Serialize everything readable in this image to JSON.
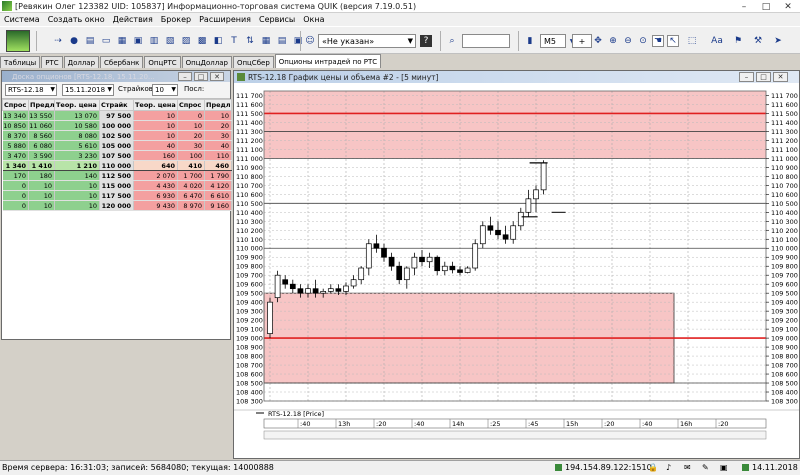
{
  "window": {
    "title": "[Ревякин Олег 123382 UID: 105837] Информационно-торговая система QUIK (версия 7.19.0.51)",
    "minimize": "–",
    "maximize": "□",
    "close": "✕"
  },
  "menu": [
    "Система",
    "Создать окно",
    "Действия",
    "Брокер",
    "Расширения",
    "Сервисы",
    "Окна"
  ],
  "toolbar": {
    "account_select": "«Не указан»",
    "interval_select": "M5",
    "zoom_label": "+",
    "fit_label": "Aa"
  },
  "tabs": [
    "Таблицы",
    "РТС",
    "Доллар",
    "Сбербанк",
    "ОпцРТС",
    "ОпцДоллар",
    "ОпцСбер",
    "Опционы интрадей по РТС"
  ],
  "options_window": {
    "title": "Доска опционов [RTS-12.18, 15.11.20...",
    "base_select": "RTS-12.18",
    "date_select": "15.11.2018",
    "strikes_label": "Страйков:",
    "strikes_value": "10",
    "after_label": "Посл:",
    "columns": [
      "Спрос",
      "Предл.",
      "Теор. цена C",
      "Страйк",
      "Теор. цена P",
      "Спрос",
      "Предл."
    ],
    "rows": [
      [
        "13 340",
        "13 550",
        "13 070",
        "97 500",
        "10",
        "0",
        "10"
      ],
      [
        "10 850",
        "11 060",
        "10 580",
        "100 000",
        "10",
        "10",
        "20"
      ],
      [
        "8 370",
        "8 560",
        "8 080",
        "102 500",
        "10",
        "20",
        "30"
      ],
      [
        "5 880",
        "6 080",
        "5 610",
        "105 000",
        "40",
        "30",
        "40"
      ],
      [
        "3 470",
        "3 590",
        "3 230",
        "107 500",
        "160",
        "100",
        "110"
      ],
      [
        "1 340",
        "1 410",
        "1 210",
        "110 000",
        "640",
        "410",
        "460"
      ],
      [
        "170",
        "180",
        "140",
        "112 500",
        "2 070",
        "1 700",
        "1 790"
      ],
      [
        "0",
        "10",
        "10",
        "115 000",
        "4 430",
        "4 020",
        "4 120"
      ],
      [
        "0",
        "10",
        "10",
        "117 500",
        "6 930",
        "6 470",
        "6 610"
      ],
      [
        "0",
        "10",
        "10",
        "120 000",
        "9 430",
        "8 970",
        "9 160"
      ]
    ],
    "current_row": 5
  },
  "chart_window": {
    "title": "RTS-12.18 График цены и объема #2 - [5 минут]",
    "legend": "RTS-12.18 [Price]"
  },
  "chart_data": {
    "type": "candlestick",
    "instrument": "RTS-12.18",
    "interval": "5 минут",
    "ylim": [
      108300,
      111750
    ],
    "yticks": [
      111700,
      111600,
      111500,
      111400,
      111300,
      111200,
      111100,
      111000,
      110900,
      110800,
      110700,
      110600,
      110500,
      110400,
      110300,
      110200,
      110100,
      110000,
      109900,
      109800,
      109700,
      109600,
      109500,
      109400,
      109300,
      109200,
      109100,
      109000,
      108900,
      108800,
      108700,
      108600,
      108500,
      108400,
      108300
    ],
    "xticks": [
      ":40",
      "13h",
      ":20",
      ":40",
      "14h",
      ":25",
      ":45",
      "15h",
      ":20",
      ":40",
      "16h",
      ":20"
    ],
    "hlines": [
      111500,
      111300,
      111000,
      110500,
      110000,
      109000,
      108500
    ],
    "red_lines": [
      111500,
      109000
    ],
    "zones": [
      {
        "from": 111750,
        "to": 111000,
        "end": "right"
      },
      {
        "from": 109500,
        "to": 108500,
        "end": "mid"
      }
    ],
    "candles": [
      {
        "o": 109050,
        "h": 109450,
        "l": 109000,
        "c": 109400
      },
      {
        "o": 109450,
        "h": 109750,
        "l": 109400,
        "c": 109700
      },
      {
        "o": 109650,
        "h": 109700,
        "l": 109550,
        "c": 109600
      },
      {
        "o": 109600,
        "h": 109650,
        "l": 109500,
        "c": 109550
      },
      {
        "o": 109550,
        "h": 109600,
        "l": 109450,
        "c": 109500
      },
      {
        "o": 109500,
        "h": 109600,
        "l": 109450,
        "c": 109550
      },
      {
        "o": 109550,
        "h": 109650,
        "l": 109450,
        "c": 109500
      },
      {
        "o": 109500,
        "h": 109550,
        "l": 109450,
        "c": 109520
      },
      {
        "o": 109520,
        "h": 109600,
        "l": 109500,
        "c": 109550
      },
      {
        "o": 109550,
        "h": 109600,
        "l": 109480,
        "c": 109520
      },
      {
        "o": 109520,
        "h": 109620,
        "l": 109480,
        "c": 109580
      },
      {
        "o": 109580,
        "h": 109700,
        "l": 109550,
        "c": 109650
      },
      {
        "o": 109650,
        "h": 109800,
        "l": 109600,
        "c": 109780
      },
      {
        "o": 109780,
        "h": 110100,
        "l": 109700,
        "c": 110050
      },
      {
        "o": 110050,
        "h": 110150,
        "l": 109950,
        "c": 110000
      },
      {
        "o": 110000,
        "h": 110050,
        "l": 109850,
        "c": 109900
      },
      {
        "o": 109900,
        "h": 109950,
        "l": 109750,
        "c": 109800
      },
      {
        "o": 109800,
        "h": 109850,
        "l": 109600,
        "c": 109650
      },
      {
        "o": 109650,
        "h": 109800,
        "l": 109550,
        "c": 109780
      },
      {
        "o": 109780,
        "h": 109950,
        "l": 109700,
        "c": 109900
      },
      {
        "o": 109900,
        "h": 109980,
        "l": 109800,
        "c": 109850
      },
      {
        "o": 109850,
        "h": 109950,
        "l": 109780,
        "c": 109900
      },
      {
        "o": 109900,
        "h": 109920,
        "l": 109700,
        "c": 109750
      },
      {
        "o": 109750,
        "h": 109850,
        "l": 109700,
        "c": 109800
      },
      {
        "o": 109800,
        "h": 109850,
        "l": 109720,
        "c": 109760
      },
      {
        "o": 109760,
        "h": 109800,
        "l": 109700,
        "c": 109730
      },
      {
        "o": 109730,
        "h": 109800,
        "l": 109720,
        "c": 109780
      },
      {
        "o": 109780,
        "h": 110100,
        "l": 109750,
        "c": 110050
      },
      {
        "o": 110050,
        "h": 110300,
        "l": 110000,
        "c": 110250
      },
      {
        "o": 110250,
        "h": 110350,
        "l": 110150,
        "c": 110200
      },
      {
        "o": 110200,
        "h": 110300,
        "l": 110100,
        "c": 110150
      },
      {
        "o": 110150,
        "h": 110250,
        "l": 110050,
        "c": 110100
      },
      {
        "o": 110100,
        "h": 110300,
        "l": 110050,
        "c": 110250
      },
      {
        "o": 110250,
        "h": 110450,
        "l": 110200,
        "c": 110400
      },
      {
        "o": 110400,
        "h": 110650,
        "l": 110350,
        "c": 110550
      },
      {
        "o": 110550,
        "h": 110700,
        "l": 110400,
        "c": 110650
      },
      {
        "o": 110650,
        "h": 110980,
        "l": 110600,
        "c": 110950
      }
    ]
  },
  "status": {
    "server_time": "Время сервера: 16:31:03; записей: 5684080; текущая: 14000888",
    "ip": "194.154.89.122:1510",
    "date": "14.11.2018"
  }
}
